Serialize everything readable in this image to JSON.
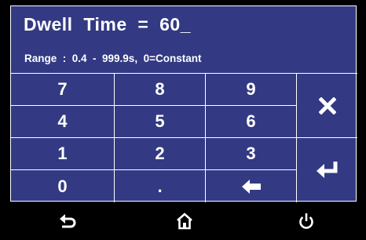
{
  "display": {
    "title": "Dwell  Time  =  60_",
    "range": "Range  :  0.4  -  999.9s,  0=Constant"
  },
  "keypad": {
    "k7": "7",
    "k8": "8",
    "k9": "9",
    "k4": "4",
    "k5": "5",
    "k6": "6",
    "k1": "1",
    "k2": "2",
    "k3": "3",
    "k0": "0",
    "kdot": "."
  },
  "icons": {
    "clear": "close-icon",
    "enter": "enter-icon",
    "backspace": "backspace-arrow-icon",
    "back": "back-icon",
    "home": "home-icon",
    "power": "power-icon"
  },
  "colors": {
    "panel": "#333a83",
    "text": "#ffffff",
    "bar": "#000000"
  }
}
